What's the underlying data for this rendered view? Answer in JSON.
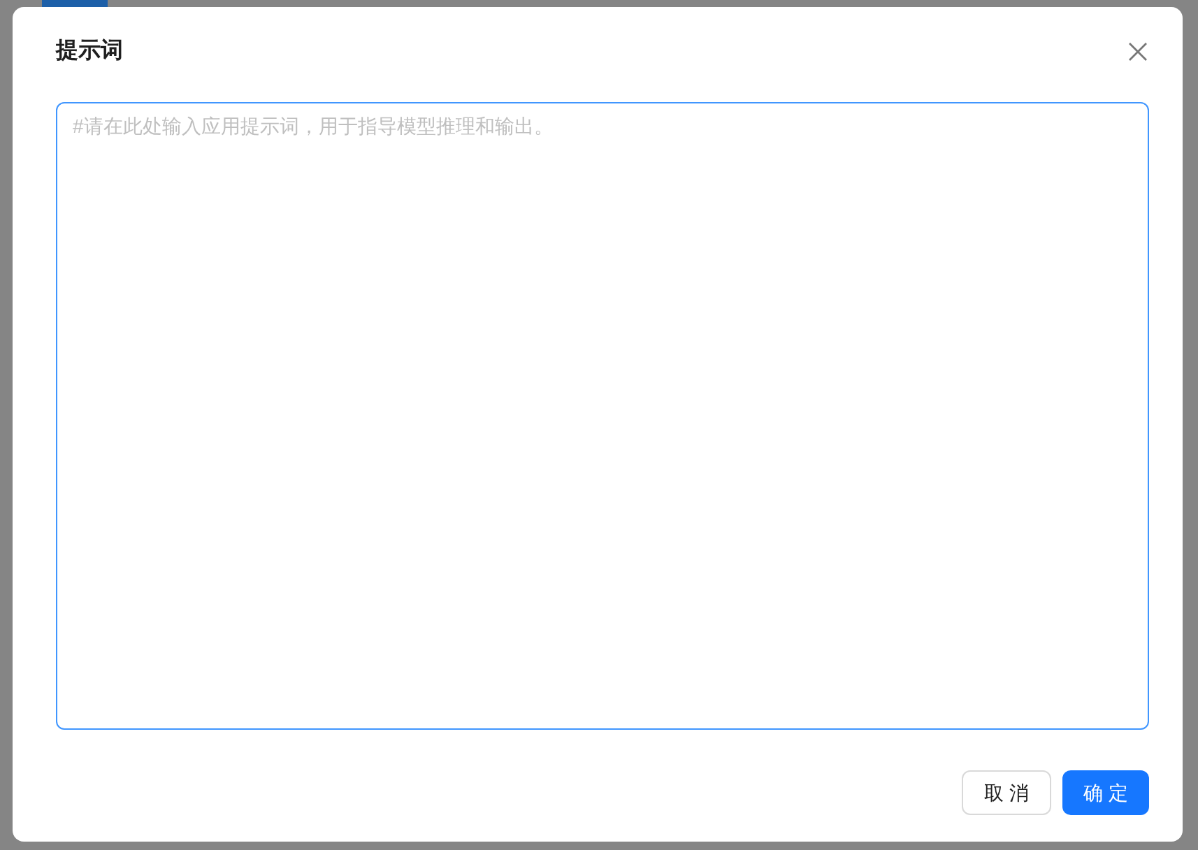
{
  "dialog": {
    "title": "提示词",
    "textarea": {
      "placeholder": "#请在此处输入应用提示词，用于指导模型推理和输出。"
    },
    "buttons": [
      {
        "label": "取 消",
        "kind": "default"
      },
      {
        "label": "确 定",
        "kind": "primary"
      }
    ]
  }
}
